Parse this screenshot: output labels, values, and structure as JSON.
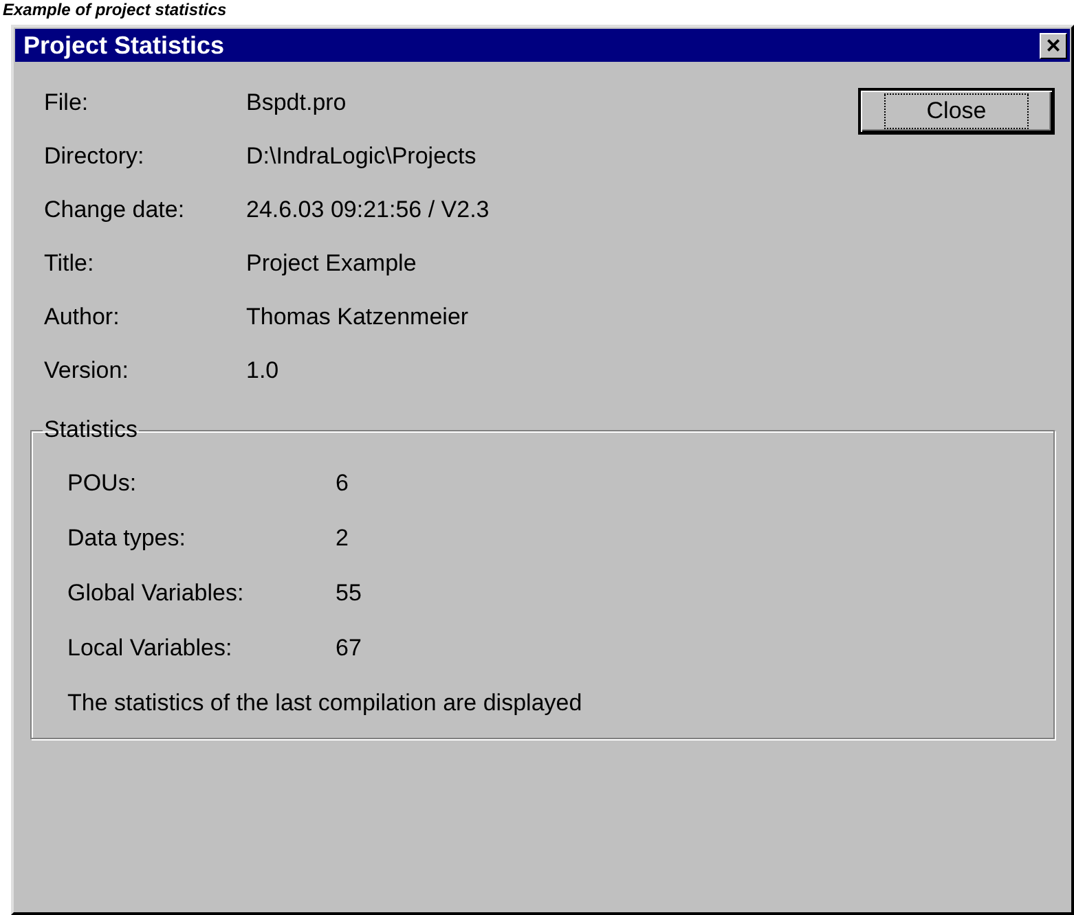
{
  "caption": "Example of project statistics",
  "window": {
    "title": "Project Statistics",
    "close_glyph": "×"
  },
  "fields": [
    {
      "label": "File:",
      "value": "Bspdt.pro"
    },
    {
      "label": "Directory:",
      "value": "D:\\IndraLogic\\Projects"
    },
    {
      "label": "Change date:",
      "value": "24.6.03 09:21:56 / V2.3"
    },
    {
      "label": "Title:",
      "value": "Project Example"
    },
    {
      "label": "Author:",
      "value": "Thomas Katzenmeier"
    },
    {
      "label": "Version:",
      "value": "1.0"
    }
  ],
  "close_button": {
    "label": "Close",
    "focused": true
  },
  "statistics": {
    "legend": "Statistics",
    "rows": [
      {
        "label": "POUs:",
        "value": "6"
      },
      {
        "label": "Data types:",
        "value": "2"
      },
      {
        "label": "Global Variables:",
        "value": "55"
      },
      {
        "label": "Local Variables:",
        "value": "67"
      }
    ],
    "note": "The statistics of the last compilation are displayed"
  }
}
